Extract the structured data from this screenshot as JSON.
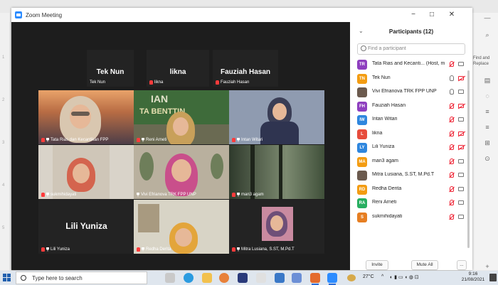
{
  "window": {
    "title": "Zoom Meeting"
  },
  "titlebar_buttons": [
    "−",
    "□",
    "✕"
  ],
  "tiles": [
    {
      "big_name": "Tek Nun",
      "label": "Tek Nun",
      "mic": "none",
      "active": false
    },
    {
      "big_name": "likna",
      "label": "likna",
      "mic": "muted",
      "active": false
    },
    {
      "big_name": "Fauziah Hasan",
      "label": "Fauziah Hasan",
      "mic": "muted",
      "active": false
    },
    {
      "big_name": "",
      "label": "Tata Rias dan Kecantikan FPP",
      "mic": "muted",
      "active": false
    },
    {
      "big_name": "",
      "label": "Reni Arneti",
      "mic": "muted",
      "active": false
    },
    {
      "big_name": "",
      "label": "Intan Witari",
      "mic": "muted",
      "active": false
    },
    {
      "big_name": "",
      "label": "sukmihidayati",
      "mic": "muted",
      "active": false
    },
    {
      "big_name": "",
      "label": "Vivi Efrianova TRK FPP UNP",
      "mic": "on",
      "active": true
    },
    {
      "big_name": "",
      "label": "man3 agam",
      "mic": "muted",
      "active": false
    },
    {
      "big_name": "Lili Yuniza",
      "label": "Lili Yuniza",
      "mic": "muted",
      "active": false
    },
    {
      "big_name": "",
      "label": "Redha Derita",
      "mic": "muted",
      "active": false
    },
    {
      "big_name": "",
      "label": "Mitra Lusiana, S.ST, M.Pd.T",
      "mic": "muted",
      "active": false
    }
  ],
  "tile_video_text": {
    "banner_top": "IAN",
    "banner_bottom": "TA BENTTIN"
  },
  "participants": {
    "title": "Participants (12)",
    "search_placeholder": "Find a participant",
    "invite_label": "Invite",
    "mute_all_label": "Mute All",
    "more_label": "...",
    "list": [
      {
        "initials": "TR",
        "color": "#8e3fbf",
        "name": "Tata Rias and Kecanti... (Host, me)",
        "mic": "off",
        "cam": "on"
      },
      {
        "initials": "TN",
        "color": "#f39c12",
        "name": "Tek Nun",
        "mic": "on",
        "cam": "off"
      },
      {
        "initials": "",
        "color": "#6b5a4e",
        "name": "Vivi Efrianova TRK FPP UNP",
        "mic": "on",
        "cam": "on"
      },
      {
        "initials": "FH",
        "color": "#8e3fbf",
        "name": "Fauziah Hasan",
        "mic": "off",
        "cam": "off"
      },
      {
        "initials": "IW",
        "color": "#2e86de",
        "name": "Intan Witari",
        "mic": "off",
        "cam": "on"
      },
      {
        "initials": "L",
        "color": "#e74c3c",
        "name": "likna",
        "mic": "off",
        "cam": "off"
      },
      {
        "initials": "LY",
        "color": "#2e86de",
        "name": "Lili Yuniza",
        "mic": "off",
        "cam": "off"
      },
      {
        "initials": "MA",
        "color": "#f39c12",
        "name": "man3 agam",
        "mic": "off",
        "cam": "on"
      },
      {
        "initials": "",
        "color": "#6b5a4e",
        "name": "Mitra Lusiana, S.ST, M.Pd.T",
        "mic": "off",
        "cam": "on"
      },
      {
        "initials": "RD",
        "color": "#f39c12",
        "name": "Redha Derita",
        "mic": "off",
        "cam": "on"
      },
      {
        "initials": "RA",
        "color": "#27ae60",
        "name": "Reni Arneti",
        "mic": "off",
        "cam": "on"
      },
      {
        "initials": "S",
        "color": "#e67e22",
        "name": "sukmihidayati",
        "mic": "off",
        "cam": "on"
      }
    ]
  },
  "background_doc": {
    "find_replace": "Find and Replace"
  },
  "taskbar": {
    "search_placeholder": "Type here to search",
    "temperature": "27°C",
    "time": "9:16",
    "date": "21/08/2021"
  }
}
